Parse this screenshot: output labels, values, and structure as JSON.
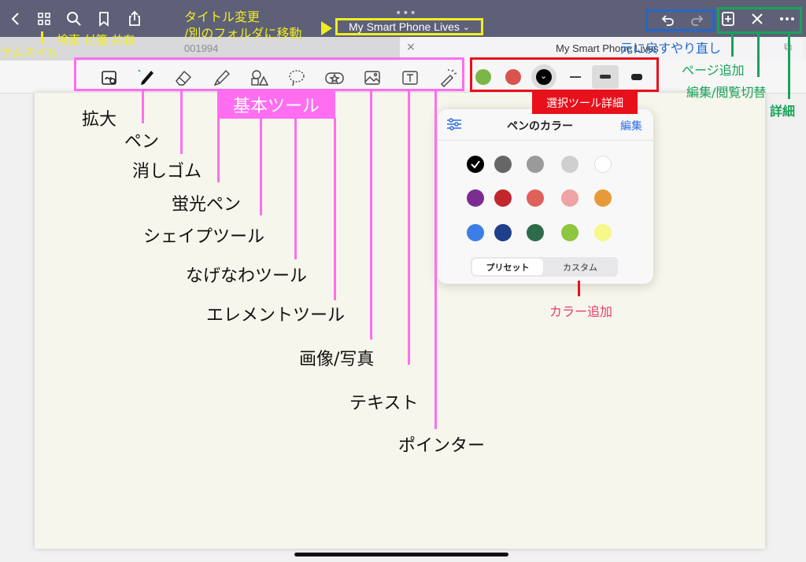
{
  "window": {
    "title": "My Smart Phone Lives",
    "title_chevron": "⌄",
    "grip": "•••",
    "tab1_label": "001994",
    "tab2_label": "My Smart Phone Lives",
    "tab2_close": "×",
    "new_tab": "⧉"
  },
  "topbar_icons": [
    "back-icon",
    "grid-icon",
    "search-icon",
    "bookmark-icon",
    "share-icon",
    "undo-icon",
    "redo-icon",
    "add-page-icon",
    "close-icon",
    "more-icon"
  ],
  "tools": [
    "zoom-icon",
    "pen-icon",
    "eraser-icon",
    "highlighter-icon",
    "shape-icon",
    "lasso-icon",
    "element-icon",
    "image-icon",
    "text-icon",
    "pointer-icon"
  ],
  "toolbar_colors": [
    "#7ab648",
    "#d9534f",
    "#000000"
  ],
  "popup": {
    "title": "ペンのカラー",
    "edit": "編集",
    "preset": "プリセット",
    "custom": "カスタム",
    "colors": [
      [
        "#000000",
        "#666666",
        "#9a9a9a",
        "#cfcfcf",
        "#ffffff"
      ],
      [
        "#7b2d91",
        "#c1272d",
        "#e0605b",
        "#f0a3a3",
        "#e8993a"
      ],
      [
        "#3c7ee8",
        "#1f3f8c",
        "#2e6b4a",
        "#8dc63f",
        "#f7f78a"
      ]
    ]
  },
  "annotations": {
    "thumbnail": "サムネイル",
    "search_tag_share": "検索 付箋 共有",
    "title_change_1": "タイトル変更",
    "title_change_2": "/別のフォルダに移動",
    "undo_redo": "元に戻すやり直し",
    "add_page": "ページ追加",
    "edit_view": "編集/閲覧切替",
    "details": "詳細",
    "basic_tools": "基本ツール",
    "selected_tool_detail": "選択ツール詳細",
    "add_color": "カラー追加",
    "zoom": "拡大",
    "pen": "ペン",
    "eraser": "消しゴム",
    "highlighter": "蛍光ペン",
    "shape": "シェイプツール",
    "lasso": "なげなわツール",
    "element": "エレメントツール",
    "image": "画像/写真",
    "text": "テキスト",
    "pointer": "ポインター"
  },
  "colors": {
    "topbar": "#5d6077",
    "annotation_yellow": "#f0ee21",
    "annotation_pink": "#ff6ef0",
    "annotation_red": "#e8101a",
    "annotation_blue": "#2268c8",
    "annotation_green": "#18a35a"
  }
}
